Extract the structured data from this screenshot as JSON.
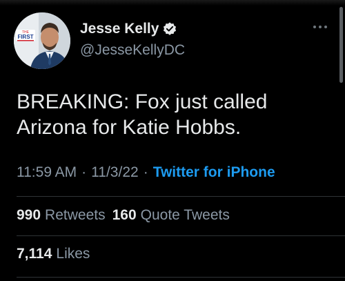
{
  "author": {
    "display_name": "Jesse Kelly",
    "handle": "@JesseKellyDC",
    "verified": true,
    "avatar_badge_text": "FIRST",
    "avatar_badge_small": "THE"
  },
  "tweet": {
    "text": "BREAKING: Fox just called Arizona for Katie Hobbs.",
    "time": "11:59 AM",
    "date": "11/3/22",
    "separator": "·",
    "source": "Twitter for iPhone"
  },
  "stats": {
    "retweets_count": "990",
    "retweets_label": "Retweets",
    "quotes_count": "160",
    "quotes_label": "Quote Tweets",
    "likes_count": "7,114",
    "likes_label": "Likes"
  },
  "colors": {
    "background": "#000000",
    "primary_text": "#e7e9ea",
    "secondary_text": "#8b98a5",
    "link": "#1d9bf0",
    "divider": "#2f3336"
  },
  "icons": {
    "verified": "verified-badge-icon",
    "more": "more-options-icon"
  }
}
